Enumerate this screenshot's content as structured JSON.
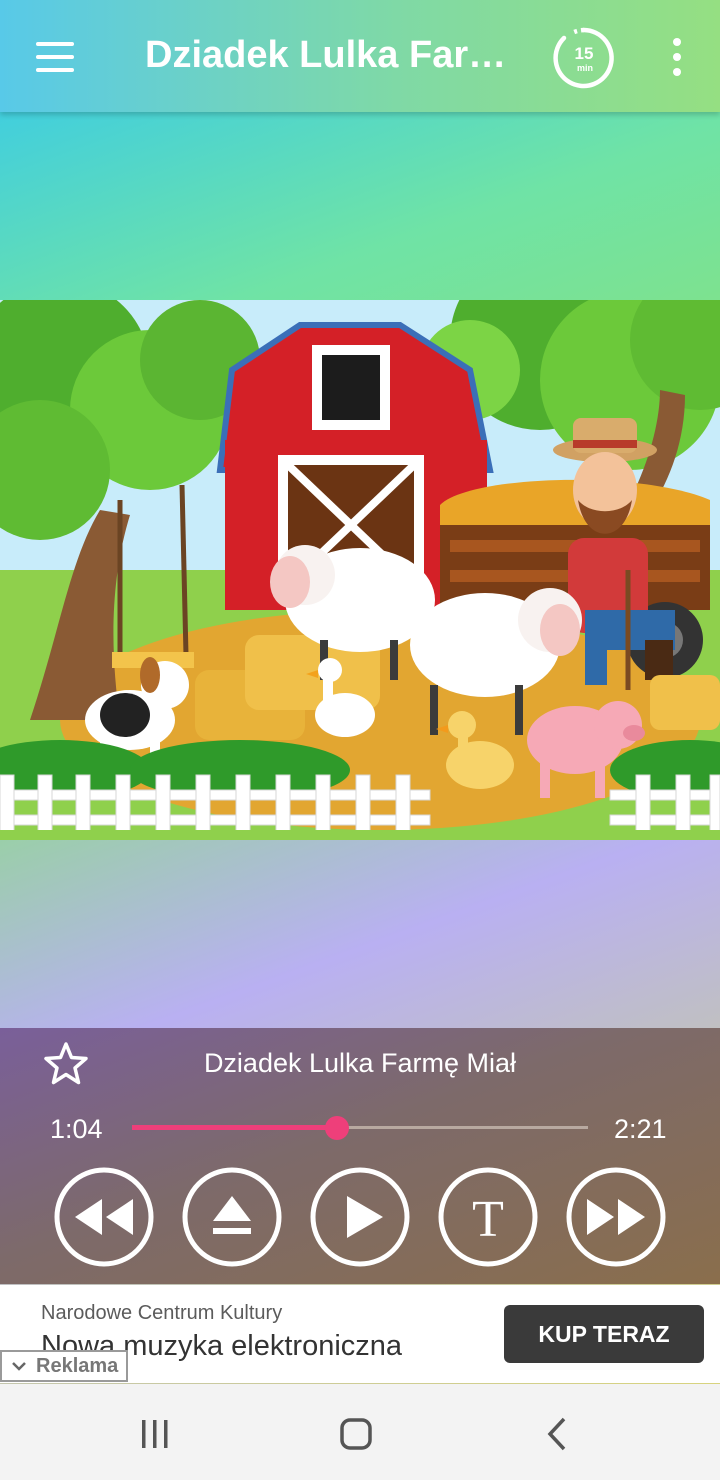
{
  "app_bar": {
    "title": "Dziadek Lulka Far…",
    "timer_value": "15",
    "timer_unit": "min"
  },
  "player": {
    "track_title": "Dziadek Lulka Farmę Miał",
    "elapsed": "1:04",
    "total": "2:21",
    "progress_fraction": 0.45,
    "progress_color": "#ee3f7a",
    "favorite_icon": "star-outline-icon",
    "lyrics_button_letter": "T",
    "controls": [
      "rewind-icon",
      "eject-icon",
      "play-icon",
      "lyrics-icon",
      "fast-forward-icon"
    ]
  },
  "ad": {
    "advertiser": "Narodowe Centrum Kultury",
    "headline": "Nowa muzyka elektroniczna",
    "cta": "KUP TERAZ",
    "label": "Reklama"
  },
  "nav_bar": {
    "buttons": [
      "recent-apps-icon",
      "home-icon",
      "back-icon"
    ]
  }
}
